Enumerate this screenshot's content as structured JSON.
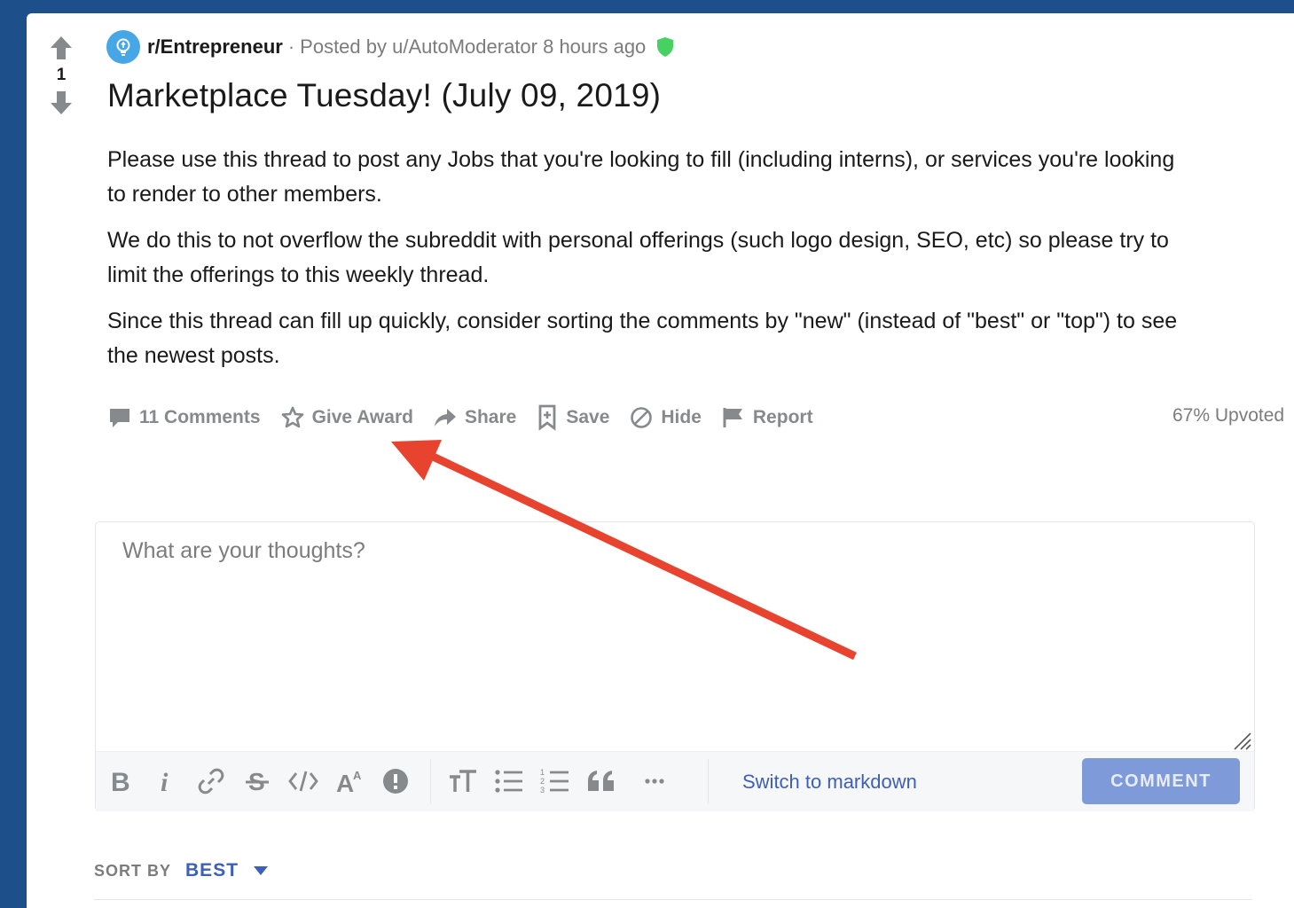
{
  "post": {
    "score": "1",
    "subreddit": "r/Entrepreneur",
    "separator": "·",
    "posted_by": "Posted by u/AutoModerator 8 hours ago",
    "title": "Marketplace Tuesday! (July 09, 2019)",
    "body": [
      "Please use this thread to post any Jobs that you're looking to fill (including interns), or services you're looking",
      "to render to other members.",
      "We do this to not overflow the subreddit with personal offerings (such logo design, SEO, etc) so please try to",
      "limit the offerings to this weekly thread.",
      "Since this thread can fill up quickly, consider sorting the comments by \"new\" (instead of \"best\" or \"top\") to see",
      "the newest posts."
    ]
  },
  "actions": {
    "comments": "11 Comments",
    "give_award": "Give Award",
    "share": "Share",
    "save": "Save",
    "hide": "Hide",
    "report": "Report",
    "upvoted": "67% Upvoted"
  },
  "editor": {
    "placeholder": "What are your thoughts?",
    "value": "",
    "switch_markdown": "Switch to markdown",
    "comment_button": "COMMENT",
    "tools": [
      "bold-icon",
      "italic-icon",
      "link-icon",
      "strikethrough-icon",
      "code-icon",
      "superscript-icon",
      "spoiler-icon",
      "heading-icon",
      "bulleted-list-icon",
      "numbered-list-icon",
      "quote-icon",
      "more-icon"
    ]
  },
  "sort": {
    "label": "SORT BY",
    "value": "BEST"
  },
  "colors": {
    "background": "#1d4f8a",
    "accent": "#3d5fb8",
    "button": "#7f9ad9",
    "annotation_arrow": "#e8432e",
    "mod_shield": "#46d160"
  }
}
